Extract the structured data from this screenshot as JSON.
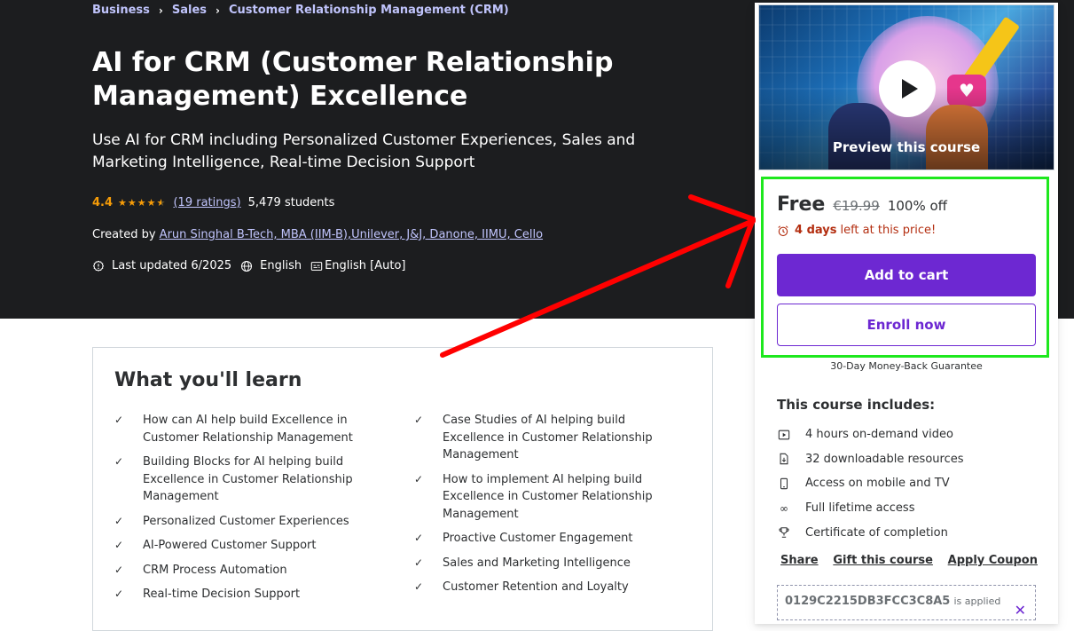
{
  "breadcrumb": [
    "Business",
    "Sales",
    "Customer Relationship Management (CRM)"
  ],
  "course": {
    "title": "AI for CRM (Customer Relationship Management) Excellence",
    "subtitle": "Use AI for CRM including Personalized Customer Experiences, Sales and Marketing Intelligence, Real-time Decision Support",
    "rating": "4.4",
    "stars": 4.4,
    "ratings_count": "(19 ratings)",
    "students": "5,479 students",
    "created_by_label": "Created by",
    "instructor": "Arun Singhal B-Tech, MBA (IIM-B),Unilever, J&J, Danone, IIMU, Cello",
    "last_updated": "Last updated 6/2025",
    "language": "English",
    "captions": "English [Auto]"
  },
  "sidebar": {
    "preview_label": "Preview this course",
    "price_free": "Free",
    "price_original": "€19.99",
    "discount": "100% off",
    "timer_bold": "4 days",
    "timer_rest": "left at this price!",
    "add_to_cart": "Add to cart",
    "enroll_now": "Enroll now",
    "guarantee": "30-Day Money-Back Guarantee",
    "includes_title": "This course includes:",
    "includes": [
      {
        "icon": "video-icon",
        "label": "4 hours on-demand video"
      },
      {
        "icon": "file-download-icon",
        "label": "32 downloadable resources"
      },
      {
        "icon": "mobile-icon",
        "label": "Access on mobile and TV"
      },
      {
        "icon": "infinity-icon",
        "label": "Full lifetime access"
      },
      {
        "icon": "trophy-icon",
        "label": "Certificate of completion"
      }
    ],
    "links": [
      "Share",
      "Gift this course",
      "Apply Coupon"
    ],
    "coupon_code": "0129C2215DB3FCC3C8A5",
    "coupon_status": "is applied"
  },
  "learn": {
    "title": "What you'll learn",
    "left": [
      "How can AI help build Excellence in Customer Relationship Management",
      "Building Blocks for AI helping build Excellence in Customer Relationship Management",
      "Personalized Customer Experiences",
      "AI-Powered Customer Support",
      "CRM Process Automation",
      "Real-time Decision Support"
    ],
    "right": [
      "Case Studies of AI helping build Excellence in Customer Relationship Management",
      "How to implement AI helping build Excellence in Customer Relationship Management",
      "Proactive Customer Engagement",
      "Sales and Marketing Intelligence",
      "Customer Retention and Loyalty"
    ]
  },
  "colors": {
    "hero_bg": "#1c1d1f",
    "accent_purple": "#6d28d2",
    "link_lavender": "#c0c4fc",
    "star_orange": "#f69c08",
    "timer_red": "#b32d0f",
    "annotation_red": "#ff0000",
    "annotation_green": "#1ee81e"
  }
}
